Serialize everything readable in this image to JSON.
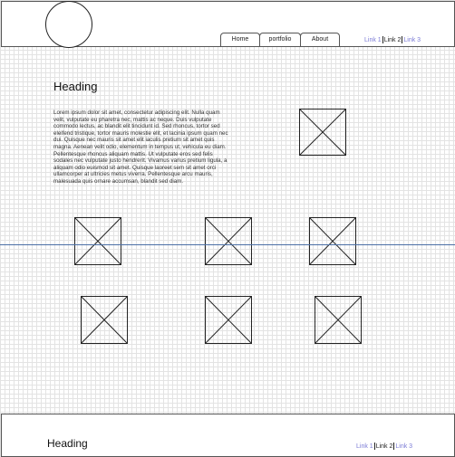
{
  "nav": {
    "home": "Home",
    "portfolio": "portfolio",
    "about": "About"
  },
  "header_links": {
    "link1": "Link 1",
    "link2": "Link 2",
    "link3": "Link 3"
  },
  "main": {
    "heading": "Heading",
    "body_text": "Lorem ipsum dolor sit amet, consectetur adipiscing elit. Nulla quam velit, vulputate eu pharetra nec, mattis ac neque. Duis vulputate commodo lectus, ac blandit elit tincidunt id. Sed rhoncus, tortor sed eleifend tristique, tortor mauris molestie elit, et lacinia ipsum quam nec dui. Quisque nec mauris sit amet elit iaculis pretium sit amet quis magna. Aenean velit odio, elementum in tempus ut, vehicula eu diam. Pellentesque rhoncus aliquam mattis. Ut vulputate eros sed felis sodales nec vulputate justo hendrerit. Vivamus varius pretium ligula, a aliquam odio euismod sit amet. Quisque laoreet sem sit amet orci ullamcorper at ultricies metus viverra. Pellentesque arcu mauris, malesuada quis ornare accumsan, blandit sed diam."
  },
  "footer": {
    "heading": "Heading",
    "link1": "Link 1",
    "link2": "Link 2",
    "link3": "Link 3"
  },
  "colors": {
    "link": "#7b7bd6",
    "divider": "#4a6fa5",
    "grid": "#e3e3e3"
  },
  "icons": [
    "logo-placeholder",
    "image-placeholder-icon"
  ]
}
